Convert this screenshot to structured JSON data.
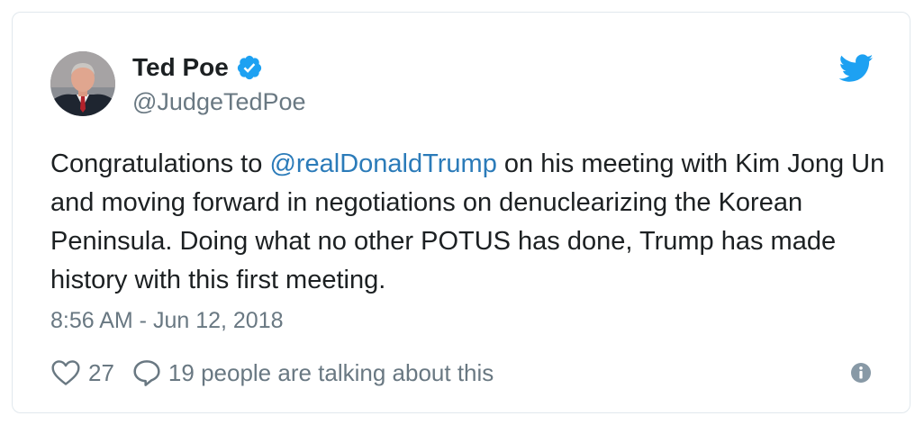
{
  "author": {
    "display_name": "Ted Poe",
    "handle": "@JudgeTedPoe",
    "verified": true,
    "avatar_icon": "profile-photo"
  },
  "tweet": {
    "text_before": "Congratulations to ",
    "mention": "@realDonaldTrump",
    "text_after": " on his meeting with Kim Jong Un and moving forward in negotiations on denuclearizing the Korean Peninsula. Doing what no other POTUS has done, Trump has made history with this first meeting.",
    "timestamp": "8:56 AM - Jun 12, 2018"
  },
  "actions": {
    "like_count": "27",
    "reply_label": "19 people are talking about this"
  },
  "icons": {
    "brand": "twitter-bird-icon",
    "verified": "verified-badge-icon",
    "like": "heart-icon",
    "reply": "speech-bubble-icon",
    "info": "info-icon"
  },
  "colors": {
    "link": "#2b7bb9",
    "brand": "#1da1f2",
    "muted": "#697882",
    "text": "#1c2022",
    "border": "#e1e8ed"
  }
}
